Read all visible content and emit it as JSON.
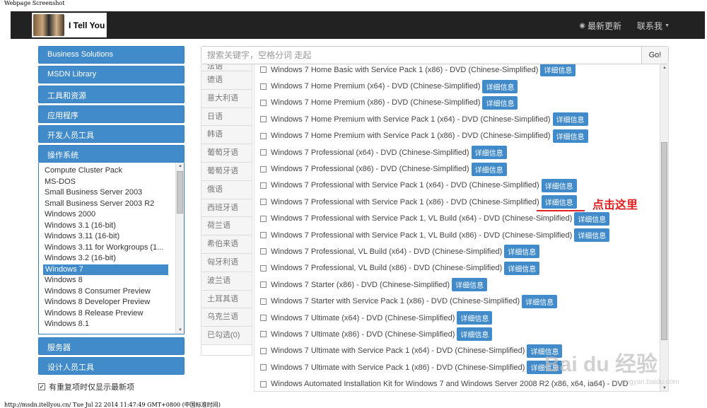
{
  "captions": {
    "top": "Webpage Screenshot",
    "bottom": "http://msdn.itellyou.cn/ Tue Jul 22 2014 11:47:49 GMT+0800 (中国标准时间)"
  },
  "navbar": {
    "brand_text": "I Tell You",
    "updates_label": "最新更新",
    "contact_label": "联系我"
  },
  "search": {
    "placeholder": "搜索关键字，空格分词 走起",
    "button_label": "Go!"
  },
  "sidebar": {
    "top_buttons": [
      "Business Solutions",
      "MSDN Library",
      "工具和资源",
      "应用程序",
      "开发人员工具",
      "操作系统"
    ],
    "os_items": [
      "Compute Cluster Pack",
      "MS-DOS",
      "Small Business Server 2003",
      "Small Business Server 2003 R2",
      "Windows 2000",
      "Windows 3.1 (16-bit)",
      "Windows 3.11 (16-bit)",
      "Windows 3.11 for Workgroups (1...",
      "Windows 3.2 (16-bit)",
      "Windows 7",
      "Windows 8",
      "Windows 8 Consumer Preview",
      "Windows 8 Developer Preview",
      "Windows 8 Release Preview",
      "Windows 8.1"
    ],
    "selected_os": "Windows 7",
    "bottom_buttons": [
      "服务器",
      "设计人员工具"
    ],
    "checkbox_label": "有重复项时仅显示最新项"
  },
  "languages": [
    "法语",
    "德语",
    "意大利语",
    "日语",
    "韩语",
    "葡萄牙语",
    "葡萄牙语",
    "俄语",
    "西班牙语",
    "荷兰语",
    "希伯来语",
    "匈牙利语",
    "波兰语",
    "土耳其语",
    "乌克兰语",
    "已勾选(0)"
  ],
  "files": {
    "detail_label": "详细信息",
    "items": [
      "Windows 7 Home Basic with Service Pack 1 (x86) - DVD (Chinese-Simplified)",
      "Windows 7 Home Premium (x64) - DVD (Chinese-Simplified)",
      "Windows 7 Home Premium (x86) - DVD (Chinese-Simplified)",
      "Windows 7 Home Premium with Service Pack 1 (x64) - DVD (Chinese-Simplified)",
      "Windows 7 Home Premium with Service Pack 1 (x86) - DVD (Chinese-Simplified)",
      "Windows 7 Professional (x64) - DVD (Chinese-Simplified)",
      "Windows 7 Professional (x86) - DVD (Chinese-Simplified)",
      "Windows 7 Professional with Service Pack 1 (x64) - DVD (Chinese-Simplified)",
      "Windows 7 Professional with Service Pack 1 (x86) - DVD (Chinese-Simplified)",
      "Windows 7 Professional with Service Pack 1, VL Build (x64) - DVD (Chinese-Simplified)",
      "Windows 7 Professional with Service Pack 1, VL Build (x86) - DVD (Chinese-Simplified)",
      "Windows 7 Professional, VL Build (x64) - DVD (Chinese-Simplified)",
      "Windows 7 Professional, VL Build (x86) - DVD (Chinese-Simplified)",
      "Windows 7 Starter (x86) - DVD (Chinese-Simplified)",
      "Windows 7 Starter with Service Pack 1 (x86) - DVD (Chinese-Simplified)",
      "Windows 7 Ultimate (x64) - DVD (Chinese-Simplified)",
      "Windows 7 Ultimate (x86) - DVD (Chinese-Simplified)",
      "Windows 7 Ultimate with Service Pack 1 (x64) - DVD (Chinese-Simplified)",
      "Windows 7 Ultimate with Service Pack 1 (x86) - DVD (Chinese-Simplified)",
      "Windows Automated Installation Kit for Windows 7 and Windows Server 2008 R2 (x86, x64, ia64) - DVD"
    ]
  },
  "annotation": {
    "text": "点击这里",
    "color": "#e02020"
  },
  "watermark": {
    "text": "Bai du 经验",
    "sub": "jingyan.baidu.com"
  },
  "colors": {
    "accent": "#428bca",
    "navbar": "#222222"
  }
}
